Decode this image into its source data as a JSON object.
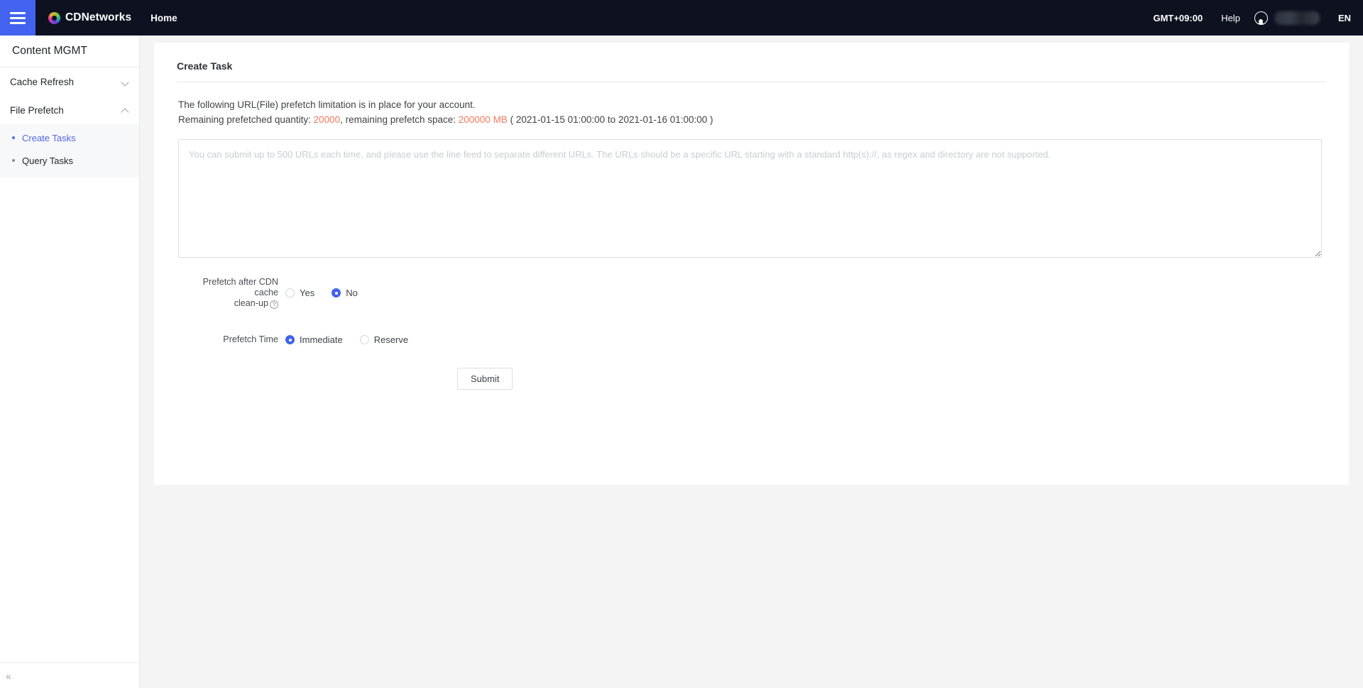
{
  "header": {
    "menu_icon": "hamburger-icon",
    "brand": "CDNetworks",
    "nav_home": "Home",
    "timezone": "GMT+09:00",
    "help": "Help",
    "account_icon": "user-avatar-icon",
    "language": "EN"
  },
  "sidebar": {
    "title": "Content MGMT",
    "groups": [
      {
        "label": "Cache Refresh",
        "expanded": false,
        "chevron": "chevron-down-icon"
      },
      {
        "label": "File Prefetch",
        "expanded": true,
        "chevron": "chevron-up-icon"
      }
    ],
    "items": [
      {
        "label": "Create Tasks",
        "active": true
      },
      {
        "label": "Query Tasks",
        "active": false
      }
    ],
    "collapse_icon": "«"
  },
  "main": {
    "card_title": "Create Task",
    "info_line1": "The following URL(File) prefetch limitation is in place for your account.",
    "info_quantity_prefix": "Remaining prefetched quantity: ",
    "info_quantity_value": "20000",
    "info_space_prefix": ", remaining prefetch space: ",
    "info_space_value": "200000 MB",
    "info_period": " ( 2021-01-15 01:00:00 to 2021-01-16 01:00:00 )",
    "urls_value": "",
    "urls_placeholder": "You can submit up to 500 URLs each time, and please use the line feed to separate different URLs. The URLs should be a specific URL starting with a standard http(s)://, as regex and directory are not supported.",
    "cache_cleanup_label_line1": "Prefetch after CDN cache",
    "cache_cleanup_label_line2": "clean-up",
    "cache_cleanup_help_icon": "question-mark-icon",
    "cache_cleanup_options": [
      {
        "label": "Yes",
        "selected": false
      },
      {
        "label": "No",
        "selected": true
      }
    ],
    "prefetch_time_label": "Prefetch Time",
    "prefetch_time_options": [
      {
        "label": "Immediate",
        "selected": true
      },
      {
        "label": "Reserve",
        "selected": false
      }
    ],
    "submit_label": "Submit"
  },
  "colors": {
    "header_bg": "#0d1120",
    "accent_blue": "#4263f0",
    "link_blue": "#5566e6",
    "accent_orange": "#f4795b",
    "page_bg": "#f4f4f5"
  }
}
